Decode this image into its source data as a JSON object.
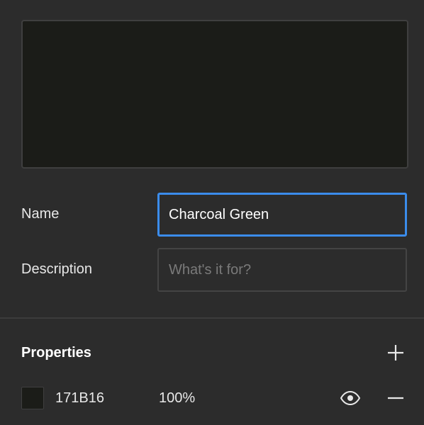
{
  "swatch": {
    "color": "#1b1c18"
  },
  "fields": {
    "name_label": "Name",
    "name_value": "Charcoal Green",
    "description_label": "Description",
    "description_placeholder": "What's it for?",
    "description_value": ""
  },
  "properties": {
    "title": "Properties",
    "add_icon": "plus-icon",
    "items": [
      {
        "color": "#1b1c18",
        "hex": "171B16",
        "opacity": "100%",
        "visibility_icon": "eye-icon",
        "remove_icon": "minus-icon"
      }
    ]
  },
  "colors": {
    "background": "#2c2c2c",
    "focus_accent": "#3b8ceb",
    "border": "#444444"
  }
}
